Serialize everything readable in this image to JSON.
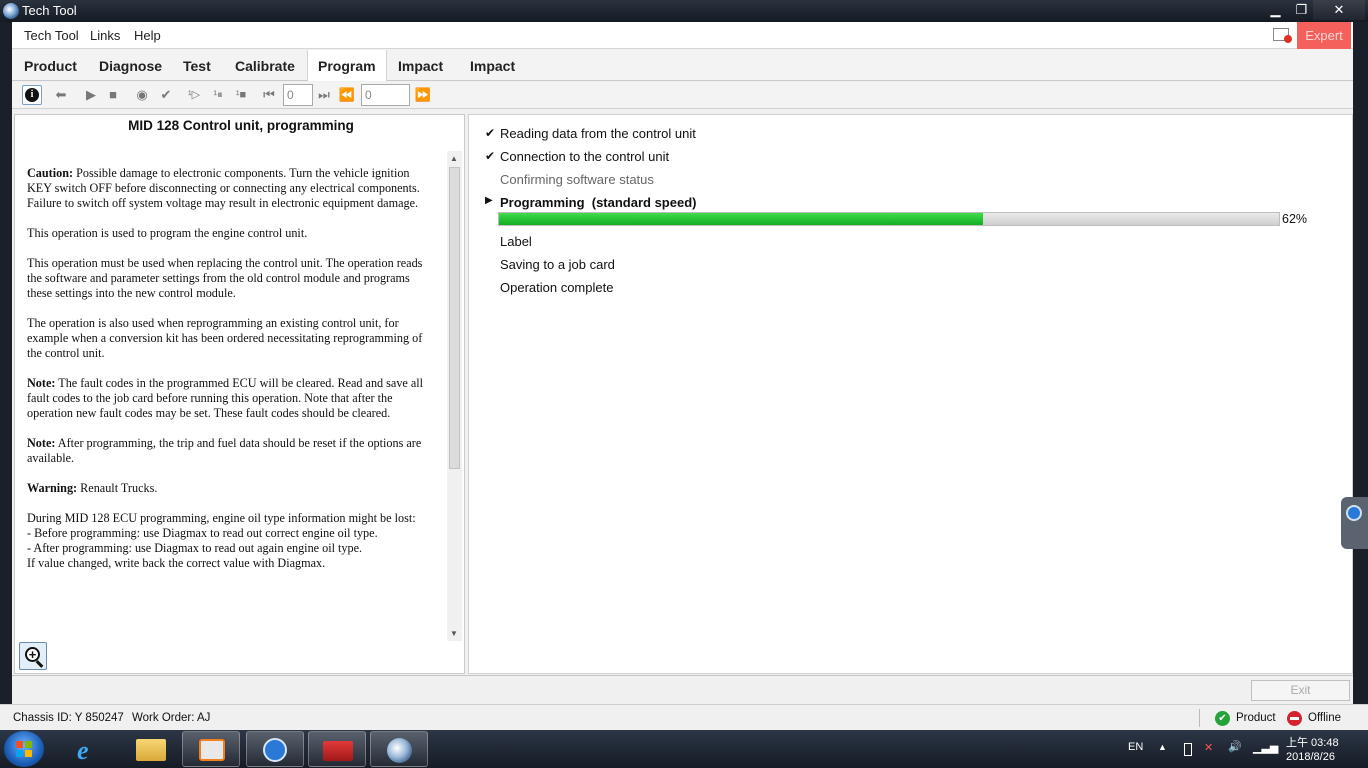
{
  "window": {
    "title": "Tech Tool"
  },
  "menu": {
    "items": [
      "Tech Tool",
      "Links",
      "Help"
    ],
    "expert_label": "Expert"
  },
  "tabs": [
    {
      "label": "Product",
      "active": false
    },
    {
      "label": "Diagnose",
      "active": false
    },
    {
      "label": "Test",
      "active": false
    },
    {
      "label": "Calibrate",
      "active": false
    },
    {
      "label": "Program",
      "active": true
    },
    {
      "label": "Impact",
      "active": false
    },
    {
      "label": "Impact",
      "active": false
    }
  ],
  "toolbar": {
    "counter1": "0",
    "counter2": "0"
  },
  "left_panel": {
    "title": "MID 128 Control unit, programming",
    "caution_label": "Caution:",
    "caution_text": " Possible damage to electronic components. Turn the vehicle ignition KEY switch OFF before disconnecting or connecting any electrical components. Failure to switch off system voltage may result in electronic equipment damage.",
    "para1": "This operation is used to program the engine control unit.",
    "para2": "This operation must be used when replacing the control unit. The operation reads the software and parameter settings from the old control module and programs these settings into the new control module.",
    "para3": "The operation is also used when reprogramming an existing control unit, for example when a conversion kit has been ordered necessitating reprogramming of the control unit.",
    "note1_label": "Note:",
    "note1_text": " The fault codes in the programmed ECU will be cleared. Read and save all fault codes to the job card before running this operation. Note that after the operation new fault codes may be set. These fault codes should be cleared.",
    "note2_label": "Note:",
    "note2_text": " After programming, the trip and fuel data should be reset if the options are available.",
    "warning_label": "Warning:",
    "warning_text": " Renault Trucks.",
    "oil_line1": "During MID 128 ECU programming, engine oil type information might be lost:",
    "oil_line2": "- Before programming: use Diagmax to read out correct engine oil type.",
    "oil_line3": "- After programming: use Diagmax to read out again engine oil type.",
    "oil_line4": "If value changed, write back the correct value with Diagmax."
  },
  "steps": {
    "s1": "Reading data from the control unit",
    "s2": "Connection to the control unit",
    "s3": "Confirming software status",
    "s4": "Programming  (standard speed)",
    "s5": "Label",
    "s6": "Saving to a job card",
    "s7": "Operation complete"
  },
  "progress": {
    "percent": 62,
    "label": "62%"
  },
  "buttons": {
    "exit": "Exit"
  },
  "status": {
    "chassis": "Chassis ID: Y 850247",
    "work_order": "Work Order: AJ",
    "product": "Product",
    "offline": "Offline"
  },
  "taskbar": {
    "lang": "EN",
    "time": "上午 03:48",
    "date": "2018/8/26"
  }
}
